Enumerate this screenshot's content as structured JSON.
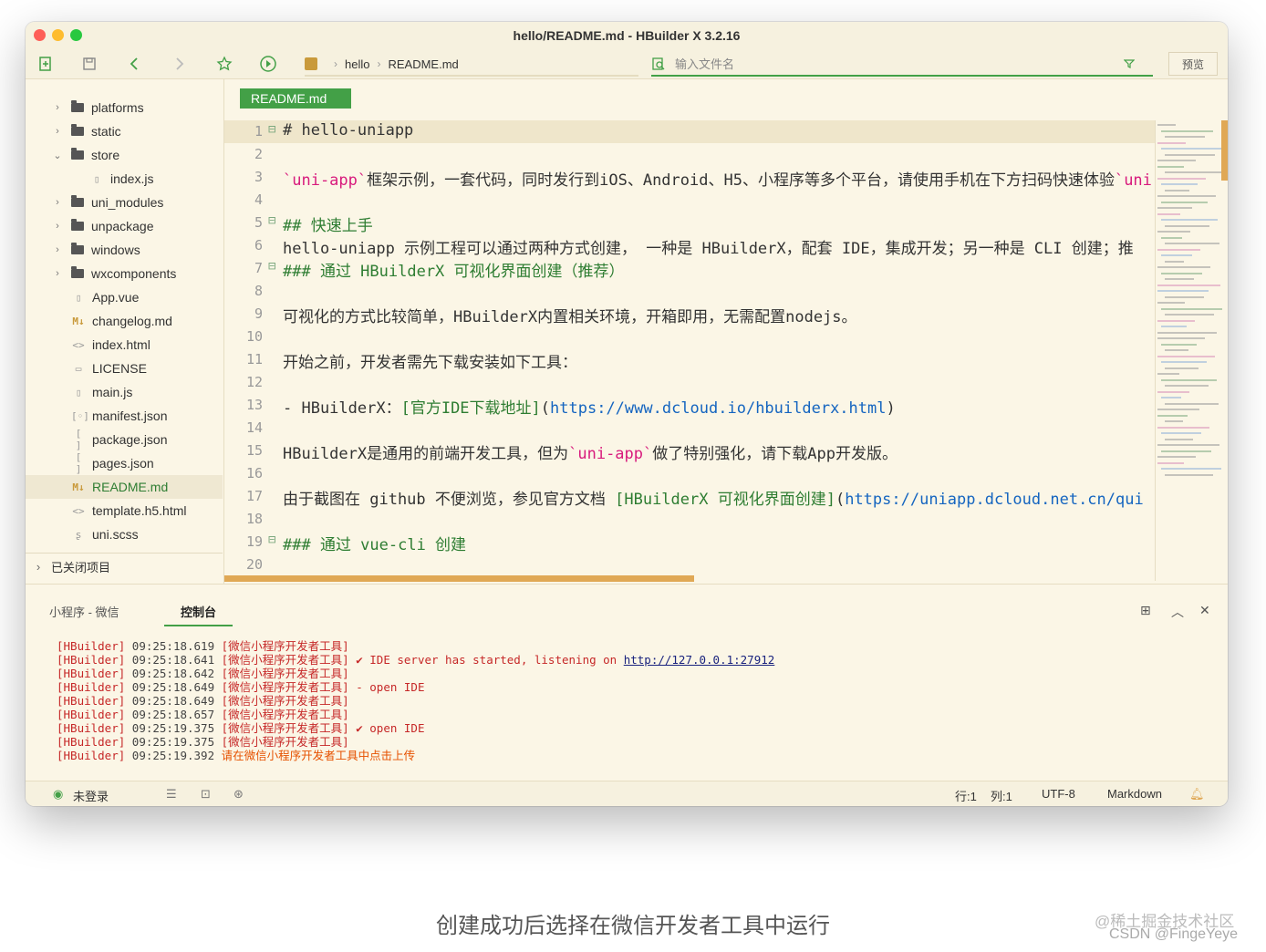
{
  "window": {
    "title": "hello/README.md - HBuilder X 3.2.16"
  },
  "toolbar": {
    "breadcrumb": [
      "hello",
      "README.md"
    ],
    "search_placeholder": "输入文件名",
    "preview_label": "预览"
  },
  "sidebar": {
    "items": [
      {
        "label": "platforms",
        "type": "folder",
        "arrow": "›"
      },
      {
        "label": "static",
        "type": "folder",
        "arrow": "›"
      },
      {
        "label": "store",
        "type": "folder",
        "arrow": "⌄"
      },
      {
        "label": "index.js",
        "type": "file",
        "icon": "▯"
      },
      {
        "label": "uni_modules",
        "type": "folder",
        "arrow": "›"
      },
      {
        "label": "unpackage",
        "type": "folder",
        "arrow": "›"
      },
      {
        "label": "windows",
        "type": "folder",
        "arrow": "›"
      },
      {
        "label": "wxcomponents",
        "type": "folder",
        "arrow": "›"
      },
      {
        "label": "App.vue",
        "type": "file",
        "icon": "▯"
      },
      {
        "label": "changelog.md",
        "type": "file",
        "icon": "M↓"
      },
      {
        "label": "index.html",
        "type": "file",
        "icon": "<>"
      },
      {
        "label": "LICENSE",
        "type": "file",
        "icon": "▭"
      },
      {
        "label": "main.js",
        "type": "file",
        "icon": "▯"
      },
      {
        "label": "manifest.json",
        "type": "file",
        "icon": "[◦]"
      },
      {
        "label": "package.json",
        "type": "file",
        "icon": "[ ]"
      },
      {
        "label": "pages.json",
        "type": "file",
        "icon": "[ ]"
      },
      {
        "label": "README.md",
        "type": "file",
        "icon": "M↓"
      },
      {
        "label": "template.h5.html",
        "type": "file",
        "icon": "<>"
      },
      {
        "label": "uni.scss",
        "type": "file",
        "icon": "ʂ"
      }
    ],
    "closed_projects": "已关闭项目"
  },
  "editor": {
    "tab": "README.md",
    "lines": [
      {
        "n": "1",
        "fold": "⊟",
        "cur": true,
        "parts": [
          [
            "n",
            "# hello-uniapp"
          ]
        ]
      },
      {
        "n": "2",
        "parts": []
      },
      {
        "n": "3",
        "parts": [
          [
            "s",
            "`uni-app`"
          ],
          [
            "n",
            "框架示例，一套代码，同时发行到iOS、Android、H5、小程序等多个平台，请使用手机在下方扫码快速体验"
          ],
          [
            "s",
            "`uni"
          ]
        ]
      },
      {
        "n": "4",
        "parts": []
      },
      {
        "n": "5",
        "fold": "⊟",
        "parts": [
          [
            "g",
            "## 快速上手"
          ]
        ]
      },
      {
        "n": "6",
        "parts": [
          [
            "n",
            "hello-uniapp 示例工程可以通过两种方式创建， 一种是 HBuilderX，配套 IDE，集成开发；另一种是 CLI 创建；推"
          ]
        ]
      },
      {
        "n": "7",
        "fold": "⊟",
        "parts": [
          [
            "g",
            "### 通过 HBuilderX 可视化界面创建（推荐）"
          ]
        ]
      },
      {
        "n": "8",
        "parts": []
      },
      {
        "n": "9",
        "parts": [
          [
            "n",
            "可视化的方式比较简单，HBuilderX内置相关环境，开箱即用，无需配置nodejs。"
          ]
        ]
      },
      {
        "n": "10",
        "parts": []
      },
      {
        "n": "11",
        "parts": [
          [
            "n",
            "开始之前，开发者需先下载安装如下工具："
          ]
        ]
      },
      {
        "n": "12",
        "parts": []
      },
      {
        "n": "13",
        "parts": [
          [
            "n",
            "- HBuilderX："
          ],
          [
            "g",
            "[官方IDE下载地址]"
          ],
          [
            "n",
            "("
          ],
          [
            "b",
            "https://www.dcloud.io/hbuilderx.html"
          ],
          [
            "n",
            ")"
          ]
        ]
      },
      {
        "n": "14",
        "parts": []
      },
      {
        "n": "15",
        "parts": [
          [
            "n",
            "HBuilderX是通用的前端开发工具，但为"
          ],
          [
            "s",
            "`uni-app`"
          ],
          [
            "n",
            "做了特别强化，请下载App开发版。"
          ]
        ]
      },
      {
        "n": "16",
        "parts": []
      },
      {
        "n": "17",
        "parts": [
          [
            "n",
            "由于截图在 github 不便浏览，参见官方文档 "
          ],
          [
            "g",
            "[HBuilderX 可视化界面创建]"
          ],
          [
            "n",
            "("
          ],
          [
            "b",
            "https://uniapp.dcloud.net.cn/qui"
          ]
        ]
      },
      {
        "n": "18",
        "parts": []
      },
      {
        "n": "19",
        "fold": "⊟",
        "parts": [
          [
            "g",
            "### 通过 vue-cli 创建"
          ]
        ]
      },
      {
        "n": "20",
        "parts": []
      }
    ]
  },
  "console": {
    "tabs": [
      "小程序 - 微信",
      "控制台"
    ],
    "logs": [
      {
        "tag": "[HBuilder]",
        "time": "09:25:18.619",
        "src": "[微信小程序开发者工具]",
        "msg": ""
      },
      {
        "tag": "[HBuilder]",
        "time": "09:25:18.641",
        "src": "[微信小程序开发者工具]",
        "msg": "✔ IDE server has started, listening on ",
        "url": "http://127.0.0.1:27912"
      },
      {
        "tag": "[HBuilder]",
        "time": "09:25:18.642",
        "src": "[微信小程序开发者工具]",
        "msg": ""
      },
      {
        "tag": "[HBuilder]",
        "time": "09:25:18.649",
        "src": "[微信小程序开发者工具]",
        "msg": "- open IDE"
      },
      {
        "tag": "[HBuilder]",
        "time": "09:25:18.649",
        "src": "[微信小程序开发者工具]",
        "msg": ""
      },
      {
        "tag": "[HBuilder]",
        "time": "09:25:18.657",
        "src": "[微信小程序开发者工具]",
        "msg": ""
      },
      {
        "tag": "[HBuilder]",
        "time": "09:25:19.375",
        "src": "[微信小程序开发者工具]",
        "msg": "✔ open IDE"
      },
      {
        "tag": "[HBuilder]",
        "time": "09:25:19.375",
        "src": "[微信小程序开发者工具]",
        "msg": ""
      },
      {
        "tag": "[HBuilder]",
        "time": "09:25:19.392",
        "src": "",
        "msg": "",
        "orange": "请在微信小程序开发者工具中点击上传"
      }
    ]
  },
  "status": {
    "login": "未登录",
    "row": "行:1",
    "col": "列:1",
    "encoding": "UTF-8",
    "language": "Markdown"
  },
  "caption": "创建成功后选择在微信开发者工具中运行",
  "watermark": [
    "@稀土掘金技术社区",
    "CSDN @FingeYeye"
  ],
  "colors": {
    "accent": "#43a047",
    "background": "#fbf6e6",
    "scroll": "#e0a855",
    "string": "#d81b7d",
    "link": "#1565c0",
    "error": "#c62828"
  }
}
